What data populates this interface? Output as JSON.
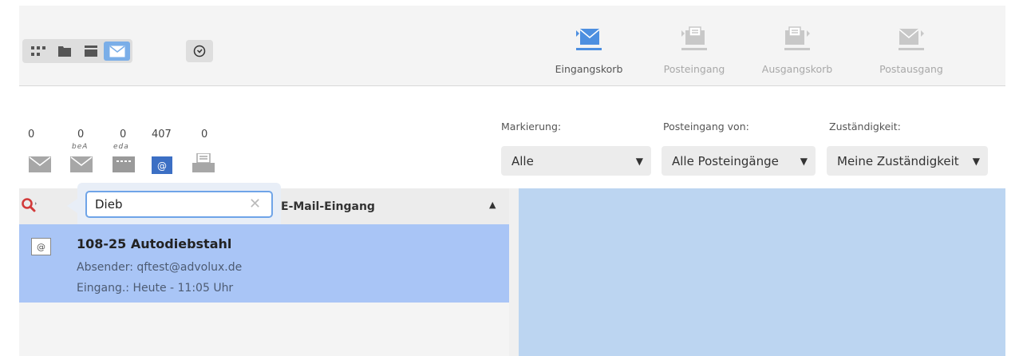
{
  "toolbar": {
    "view_buttons": [
      {
        "icon": "grid-icon",
        "active": false
      },
      {
        "icon": "folder-icon",
        "active": false
      },
      {
        "icon": "card-icon",
        "active": false
      },
      {
        "icon": "mail-icon",
        "active": true
      }
    ],
    "clock_icon": "clock-icon",
    "mailboxes": [
      {
        "label": "Eingangskorb",
        "icon": "inbox-tray-in-icon",
        "active": true
      },
      {
        "label": "Posteingang",
        "icon": "inbox-doc-in-icon",
        "active": false
      },
      {
        "label": "Ausgangskorb",
        "icon": "outbox-doc-out-icon",
        "active": false
      },
      {
        "label": "Postausgang",
        "icon": "outbox-mail-out-icon",
        "active": false
      }
    ]
  },
  "counters": [
    {
      "count": "0",
      "icon": "envelope-icon",
      "sublabel": ""
    },
    {
      "count": "0",
      "icon": "bea-envelope-icon",
      "sublabel": "beA"
    },
    {
      "count": "0",
      "icon": "eda-icon",
      "sublabel": "eda"
    },
    {
      "count": "407",
      "icon": "email-at-icon",
      "sublabel": ""
    },
    {
      "count": "0",
      "icon": "fax-icon",
      "sublabel": ""
    }
  ],
  "filters": {
    "markierung": {
      "label": "Markierung:",
      "value": "Alle"
    },
    "posteingang_von": {
      "label": "Posteingang von:",
      "value": "Alle Posteingänge"
    },
    "zustaendigkeit": {
      "label": "Zuständigkeit:",
      "value": "Meine Zuständigkeit"
    }
  },
  "list": {
    "header_title": "E-Mail-Eingang",
    "sort_indicator": "▲",
    "search": {
      "value": "Dieb",
      "clear": "✕"
    }
  },
  "items": [
    {
      "badge": "@",
      "subject": "108-25 Autodiebstahl",
      "sender": "Absender: qftest@advolux.de",
      "date": "Eingang.: Heute - 11:05 Uhr"
    }
  ],
  "colors": {
    "accent": "#7aaee8",
    "selected_row": "#a9c5f6",
    "preview_bg": "#bcd5f1",
    "search_icon": "#d23a3a"
  }
}
